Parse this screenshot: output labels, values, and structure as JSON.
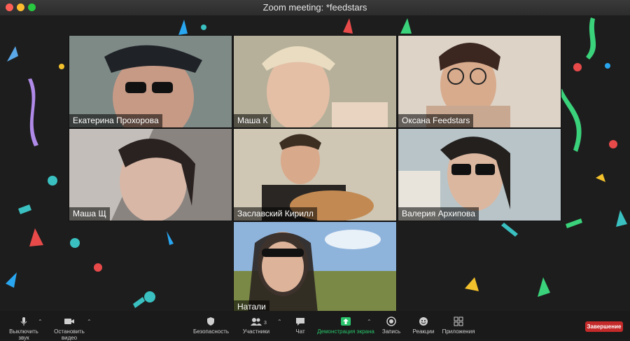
{
  "window": {
    "title": "Zoom meeting: *feedstars"
  },
  "participants": [
    {
      "name": "Екатерина Прохорова",
      "bg": "#7e8a86",
      "skin": "#c79a86",
      "hair": "#1f2328"
    },
    {
      "name": "Маша К",
      "bg": "#b6b09a",
      "skin": "#e4bfa6",
      "hair": "#e9dcc0"
    },
    {
      "name": "Оксана Feedstars",
      "bg": "#ddd3c7",
      "skin": "#d8ab8d",
      "hair": "#3b2720"
    },
    {
      "name": "Маша Щ",
      "bg": "#8a8480",
      "skin": "#d8b7a6",
      "hair": "#2a2220"
    },
    {
      "name": "Заславский Кирилл",
      "bg": "#cfc6b4",
      "skin": "#d9a98b",
      "hair": "#3d2e22"
    },
    {
      "name": "Валерия Архипова",
      "bg": "#b8c4c8",
      "skin": "#dcb7a0",
      "hair": "#23201e"
    },
    {
      "name": "Натали",
      "bg": "#8fb4dc",
      "skin": "#ddb39a",
      "hair": "#2b2420"
    }
  ],
  "toolbar": {
    "mute_label": "Выключить звук",
    "video_label": "Остановить видео",
    "security_label": "Безопасность",
    "participants_label": "Участники",
    "participants_count": "3",
    "chat_label": "Чат",
    "share_label": "Демонстрация экрана",
    "record_label": "Запись",
    "reactions_label": "Реакции",
    "apps_label": "Приложения",
    "end_label": "Завершение"
  },
  "colors": {
    "share_green": "#29c46b",
    "end_red": "#c52a2a"
  }
}
